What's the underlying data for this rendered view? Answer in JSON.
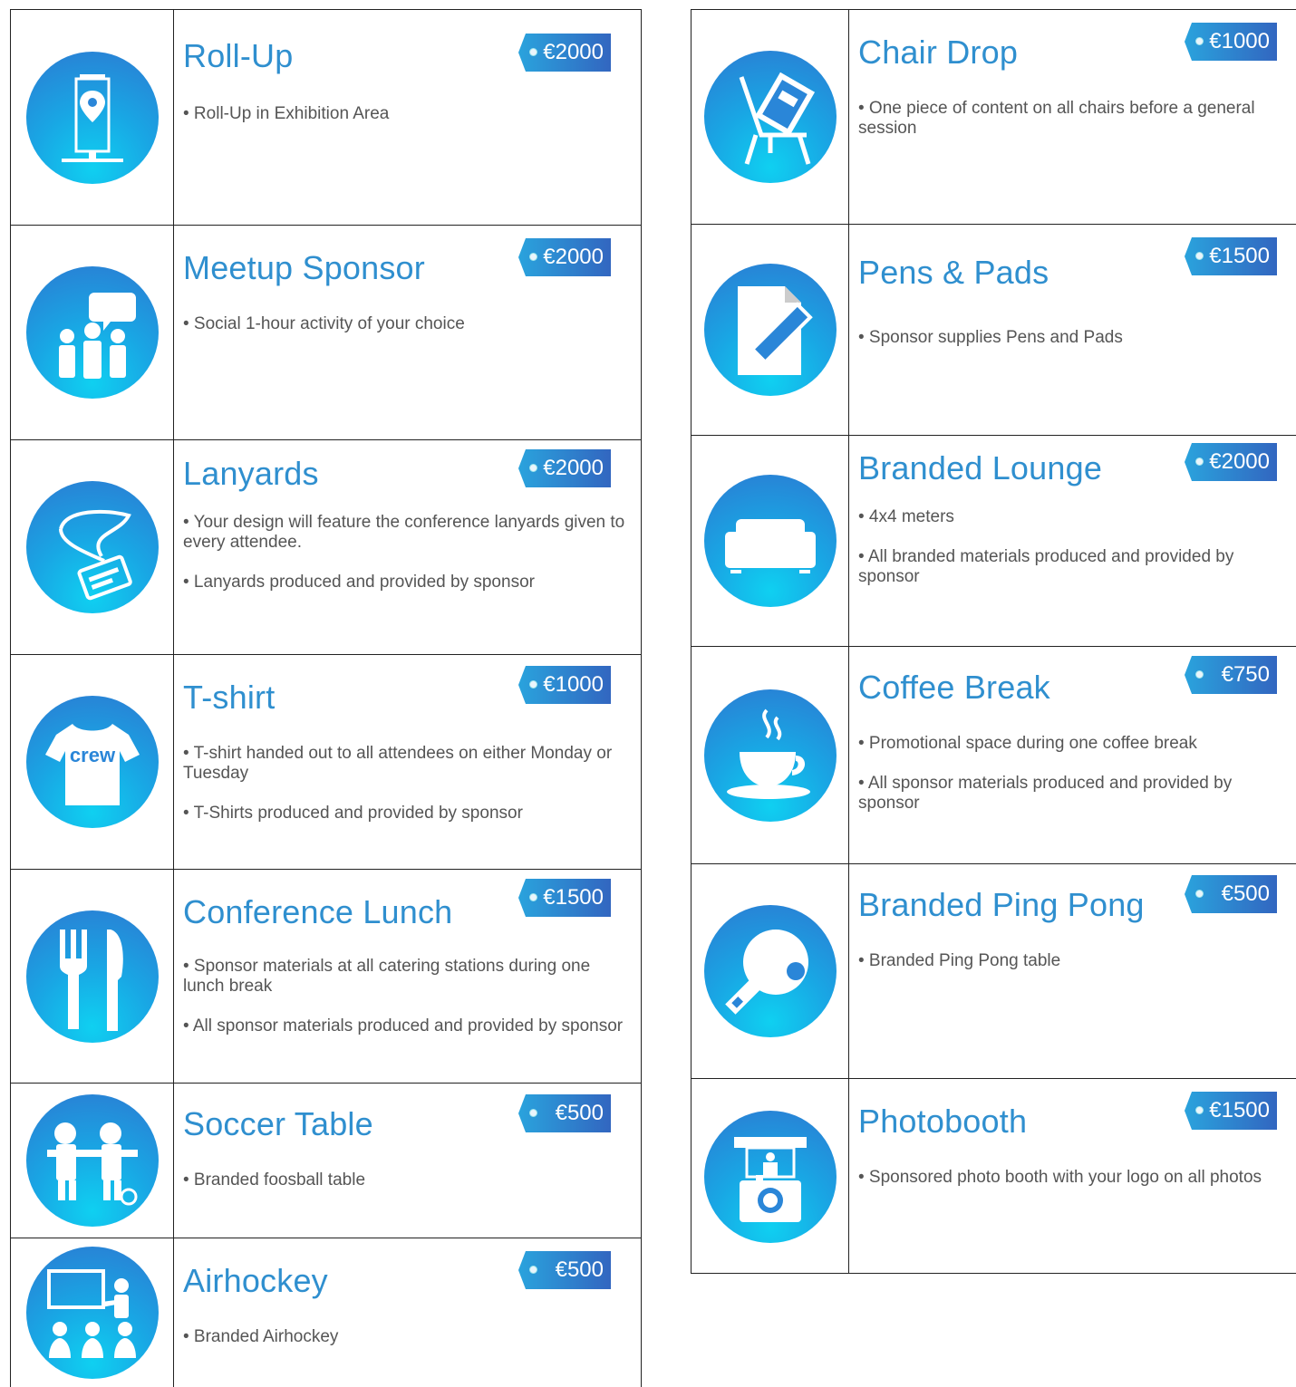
{
  "left_items": [
    {
      "title": "Roll-Up",
      "price": "€2000",
      "icon": "roll-up-banner-icon",
      "bullets": [
        "• Roll-Up in Exhibition Area"
      ]
    },
    {
      "title": "Meetup Sponsor",
      "price": "€2000",
      "icon": "meetup-people-icon",
      "bullets": [
        "• Social 1-hour activity of your choice"
      ]
    },
    {
      "title": "Lanyards",
      "price": "€2000",
      "icon": "lanyard-badge-icon",
      "bullets": [
        "• Your design will feature the conference lanyards given to every attendee.",
        "• Lanyards produced and provided by sponsor"
      ]
    },
    {
      "title": "T-shirt",
      "price": "€1000",
      "icon": "tshirt-icon",
      "bullets": [
        "• T-shirt handed out to all attendees on either Monday or Tuesday",
        "• T-Shirts produced and provided by sponsor"
      ],
      "icon_text": "crew"
    },
    {
      "title": "Conference Lunch",
      "price": "€1500",
      "icon": "fork-knife-icon",
      "bullets": [
        "• Sponsor materials at all catering stations during one lunch break",
        "• All sponsor materials produced and provided by sponsor"
      ]
    },
    {
      "title": "Soccer Table",
      "price": "€500",
      "icon": "foosball-players-icon",
      "bullets": [
        "• Branded foosball table"
      ]
    },
    {
      "title": "Airhockey",
      "price": "€500",
      "icon": "presentation-audience-icon",
      "bullets": [
        "• Branded Airhockey"
      ]
    }
  ],
  "right_items": [
    {
      "title": "Chair Drop",
      "price": "€1000",
      "icon": "chair-drop-icon",
      "bullets": [
        "• One piece of content on all chairs before a general session"
      ]
    },
    {
      "title": "Pens & Pads",
      "price": "€1500",
      "icon": "pen-pad-icon",
      "bullets": [
        "• Sponsor supplies Pens and Pads"
      ]
    },
    {
      "title": "Branded Lounge",
      "price": "€2000",
      "icon": "sofa-icon",
      "bullets": [
        "• 4x4 meters",
        "• All branded materials produced and provided by sponsor"
      ]
    },
    {
      "title": "Coffee Break",
      "price": "€750",
      "icon": "coffee-cup-icon",
      "bullets": [
        "• Promotional space during one coffee break",
        "• All sponsor materials produced and provided by sponsor"
      ]
    },
    {
      "title": "Branded Ping Pong",
      "price": "€500",
      "icon": "ping-pong-paddle-icon",
      "bullets": [
        "• Branded Ping Pong table"
      ]
    },
    {
      "title": "Photobooth",
      "price": "€1500",
      "icon": "photobooth-camera-icon",
      "bullets": [
        "• Sponsored photo booth with your logo on all photos"
      ]
    }
  ]
}
